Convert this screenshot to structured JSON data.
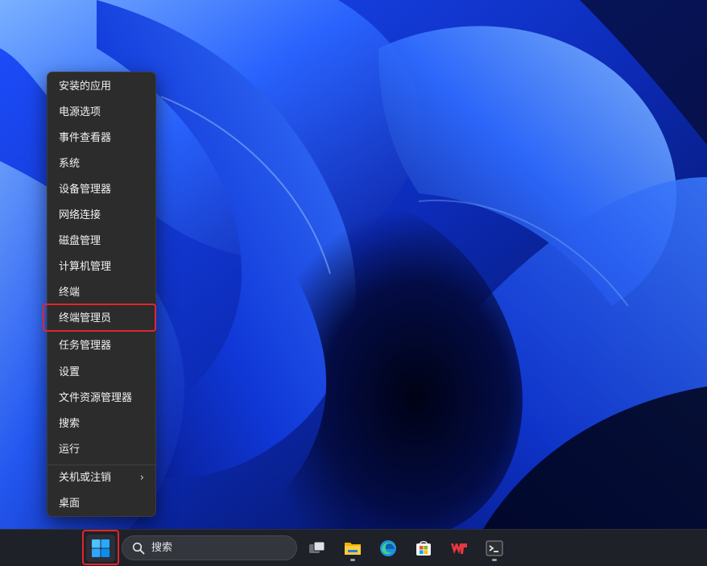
{
  "start_menu": {
    "items": [
      {
        "label": "安装的应用"
      },
      {
        "label": "电源选项"
      },
      {
        "label": "事件查看器"
      },
      {
        "label": "系统"
      },
      {
        "label": "设备管理器"
      },
      {
        "label": "网络连接"
      },
      {
        "label": "磁盘管理"
      },
      {
        "label": "计算机管理"
      },
      {
        "label": "终端"
      },
      {
        "label": "终端管理员"
      },
      {
        "label": "任务管理器"
      },
      {
        "label": "设置"
      },
      {
        "label": "文件资源管理器"
      },
      {
        "label": "搜索"
      },
      {
        "label": "运行"
      },
      {
        "label": "关机或注销",
        "chevron": "›"
      },
      {
        "label": "桌面"
      }
    ],
    "highlighted_item": "终端管理员",
    "highlight_color": "#e0262b"
  },
  "taskbar": {
    "search": {
      "label": "搜索",
      "icon": "search-icon"
    },
    "icons": [
      {
        "name": "start-button",
        "icon": "windows-logo-icon",
        "highlighted": true
      },
      {
        "name": "task-view-button",
        "icon": "task-view-icon"
      },
      {
        "name": "file-explorer-button",
        "icon": "folder-icon",
        "running": true
      },
      {
        "name": "edge-button",
        "icon": "edge-icon"
      },
      {
        "name": "store-button",
        "icon": "store-icon"
      },
      {
        "name": "wps-button",
        "icon": "wps-icon"
      },
      {
        "name": "terminal-button",
        "icon": "terminal-icon",
        "running": true
      }
    ]
  }
}
